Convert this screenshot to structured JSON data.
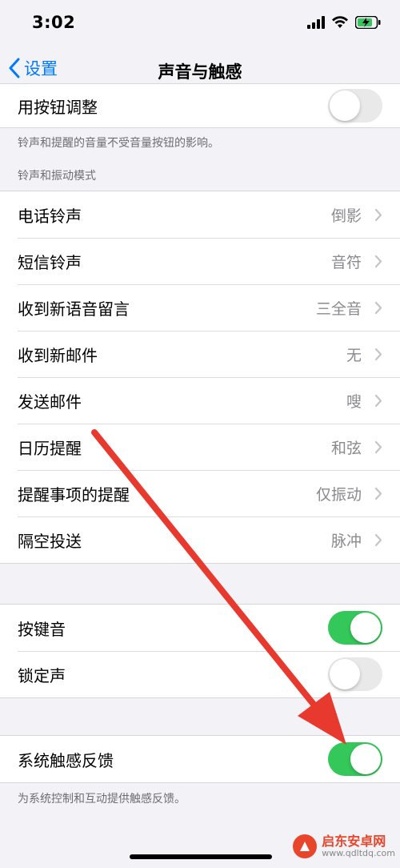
{
  "status_bar": {
    "time": "3:02"
  },
  "nav": {
    "back_label": "设置",
    "title": "声音与触感"
  },
  "ringer_group": {
    "rows": [
      {
        "label": "用按钮调整",
        "toggle_on": false
      }
    ],
    "footer": "铃声和提醒的音量不受音量按钮的影响。"
  },
  "sounds_header": "铃声和振动模式",
  "sounds_group": {
    "rows": [
      {
        "label": "电话铃声",
        "value": "倒影"
      },
      {
        "label": "短信铃声",
        "value": "音符"
      },
      {
        "label": "收到新语音留言",
        "value": "三全音"
      },
      {
        "label": "收到新邮件",
        "value": "无"
      },
      {
        "label": "发送邮件",
        "value": "嗖"
      },
      {
        "label": "日历提醒",
        "value": "和弦"
      },
      {
        "label": "提醒事项的提醒",
        "value": "仅振动"
      },
      {
        "label": "隔空投送",
        "value": "脉冲"
      }
    ]
  },
  "keyboard_group": {
    "rows": [
      {
        "label": "按键音",
        "toggle_on": true
      },
      {
        "label": "锁定声",
        "toggle_on": false
      }
    ]
  },
  "haptics_group": {
    "rows": [
      {
        "label": "系统触感反馈",
        "toggle_on": true
      }
    ],
    "footer": "为系统控制和互动提供触感反馈。"
  },
  "watermark": {
    "name": "启东安卓网",
    "url": "www.qdltdq.com"
  },
  "colors": {
    "accent": "#007aff",
    "toggle_on": "#34c759",
    "annotation_arrow": "#e8392f"
  }
}
